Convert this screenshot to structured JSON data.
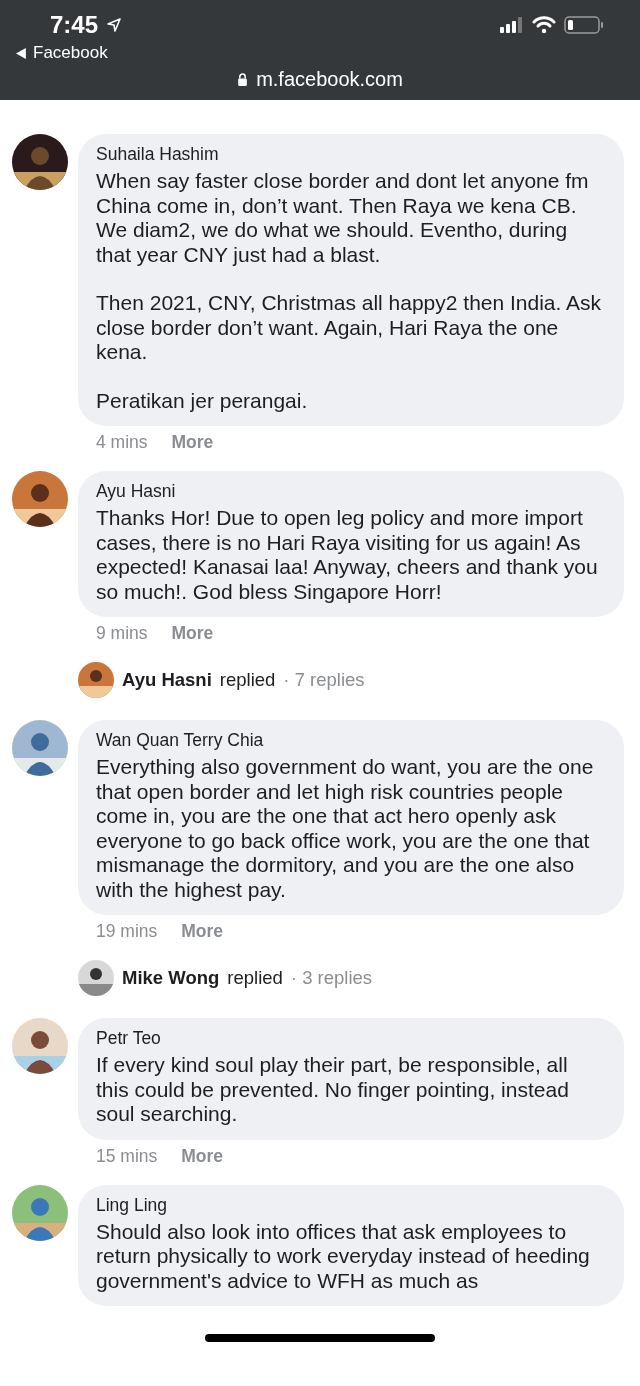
{
  "status_bar": {
    "time": "7:45",
    "back_label": "Facebook",
    "url": "m.facebook.com"
  },
  "feed": [
    {
      "kind": "comment",
      "author": "Suhaila Hashim",
      "paragraphs": [
        "When say faster close border and dont let anyone fm China come in, don’t want. Then Raya we kena CB. We diam2, we do what we should. Eventho, during that year CNY just had a blast.",
        "Then 2021, CNY, Christmas all happy2 then India. Ask close border don’t want. Again, Hari Raya the one kena.",
        "Peratikan jer perangai."
      ],
      "time": "4 mins",
      "action": "More"
    },
    {
      "kind": "comment",
      "author": "Ayu Hasni",
      "paragraphs": [
        "Thanks Hor! Due to open leg policy and more import cases, there is no Hari Raya visiting for us again! As expected! Kanasai laa! Anyway, cheers and thank you so much!. God bless Singapore Horr!"
      ],
      "time": "9 mins",
      "action": "More"
    },
    {
      "kind": "reply",
      "author": "Ayu Hasni",
      "verb": "replied",
      "count": "· 7 replies"
    },
    {
      "kind": "comment",
      "author": "Wan Quan Terry Chia",
      "paragraphs": [
        "Everything also government do want, you are the one that open border and let high risk countries people come in, you are the one that act hero openly ask everyone to go back office work, you are the one that mismanage the dormitory, and you are the one also with the highest pay."
      ],
      "time": "19 mins",
      "action": "More"
    },
    {
      "kind": "reply",
      "author": "Mike Wong",
      "verb": "replied",
      "count": "· 3 replies"
    },
    {
      "kind": "comment",
      "author": "Petr Teo",
      "paragraphs": [
        "If every kind soul play their part, be responsible, all this could be prevented. No finger pointing, instead soul searching."
      ],
      "time": "15 mins",
      "action": "More"
    },
    {
      "kind": "comment",
      "author": "Ling Ling",
      "paragraphs": [
        "Should also look into offices that ask employees to return physically to work everyday instead of heeding government's advice to WFH as much as"
      ]
    }
  ]
}
